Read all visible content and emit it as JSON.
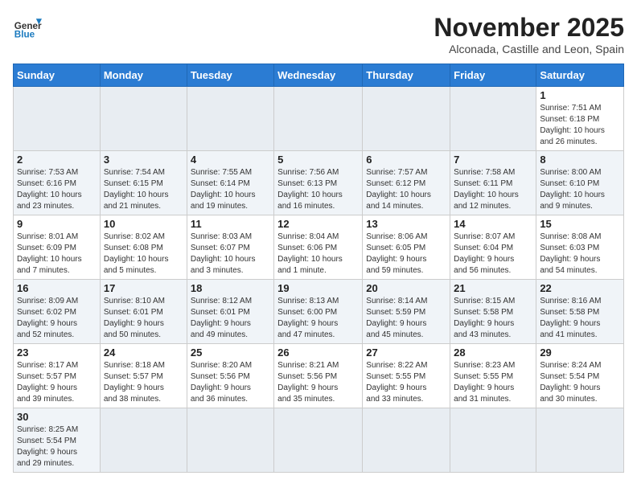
{
  "header": {
    "logo_general": "General",
    "logo_blue": "Blue",
    "month": "November 2025",
    "location": "Alconada, Castille and Leon, Spain"
  },
  "weekdays": [
    "Sunday",
    "Monday",
    "Tuesday",
    "Wednesday",
    "Thursday",
    "Friday",
    "Saturday"
  ],
  "weeks": [
    [
      {
        "day": "",
        "info": ""
      },
      {
        "day": "",
        "info": ""
      },
      {
        "day": "",
        "info": ""
      },
      {
        "day": "",
        "info": ""
      },
      {
        "day": "",
        "info": ""
      },
      {
        "day": "",
        "info": ""
      },
      {
        "day": "1",
        "info": "Sunrise: 7:51 AM\nSunset: 6:18 PM\nDaylight: 10 hours\nand 26 minutes."
      }
    ],
    [
      {
        "day": "2",
        "info": "Sunrise: 7:53 AM\nSunset: 6:16 PM\nDaylight: 10 hours\nand 23 minutes."
      },
      {
        "day": "3",
        "info": "Sunrise: 7:54 AM\nSunset: 6:15 PM\nDaylight: 10 hours\nand 21 minutes."
      },
      {
        "day": "4",
        "info": "Sunrise: 7:55 AM\nSunset: 6:14 PM\nDaylight: 10 hours\nand 19 minutes."
      },
      {
        "day": "5",
        "info": "Sunrise: 7:56 AM\nSunset: 6:13 PM\nDaylight: 10 hours\nand 16 minutes."
      },
      {
        "day": "6",
        "info": "Sunrise: 7:57 AM\nSunset: 6:12 PM\nDaylight: 10 hours\nand 14 minutes."
      },
      {
        "day": "7",
        "info": "Sunrise: 7:58 AM\nSunset: 6:11 PM\nDaylight: 10 hours\nand 12 minutes."
      },
      {
        "day": "8",
        "info": "Sunrise: 8:00 AM\nSunset: 6:10 PM\nDaylight: 10 hours\nand 9 minutes."
      }
    ],
    [
      {
        "day": "9",
        "info": "Sunrise: 8:01 AM\nSunset: 6:09 PM\nDaylight: 10 hours\nand 7 minutes."
      },
      {
        "day": "10",
        "info": "Sunrise: 8:02 AM\nSunset: 6:08 PM\nDaylight: 10 hours\nand 5 minutes."
      },
      {
        "day": "11",
        "info": "Sunrise: 8:03 AM\nSunset: 6:07 PM\nDaylight: 10 hours\nand 3 minutes."
      },
      {
        "day": "12",
        "info": "Sunrise: 8:04 AM\nSunset: 6:06 PM\nDaylight: 10 hours\nand 1 minute."
      },
      {
        "day": "13",
        "info": "Sunrise: 8:06 AM\nSunset: 6:05 PM\nDaylight: 9 hours\nand 59 minutes."
      },
      {
        "day": "14",
        "info": "Sunrise: 8:07 AM\nSunset: 6:04 PM\nDaylight: 9 hours\nand 56 minutes."
      },
      {
        "day": "15",
        "info": "Sunrise: 8:08 AM\nSunset: 6:03 PM\nDaylight: 9 hours\nand 54 minutes."
      }
    ],
    [
      {
        "day": "16",
        "info": "Sunrise: 8:09 AM\nSunset: 6:02 PM\nDaylight: 9 hours\nand 52 minutes."
      },
      {
        "day": "17",
        "info": "Sunrise: 8:10 AM\nSunset: 6:01 PM\nDaylight: 9 hours\nand 50 minutes."
      },
      {
        "day": "18",
        "info": "Sunrise: 8:12 AM\nSunset: 6:01 PM\nDaylight: 9 hours\nand 49 minutes."
      },
      {
        "day": "19",
        "info": "Sunrise: 8:13 AM\nSunset: 6:00 PM\nDaylight: 9 hours\nand 47 minutes."
      },
      {
        "day": "20",
        "info": "Sunrise: 8:14 AM\nSunset: 5:59 PM\nDaylight: 9 hours\nand 45 minutes."
      },
      {
        "day": "21",
        "info": "Sunrise: 8:15 AM\nSunset: 5:58 PM\nDaylight: 9 hours\nand 43 minutes."
      },
      {
        "day": "22",
        "info": "Sunrise: 8:16 AM\nSunset: 5:58 PM\nDaylight: 9 hours\nand 41 minutes."
      }
    ],
    [
      {
        "day": "23",
        "info": "Sunrise: 8:17 AM\nSunset: 5:57 PM\nDaylight: 9 hours\nand 39 minutes."
      },
      {
        "day": "24",
        "info": "Sunrise: 8:18 AM\nSunset: 5:57 PM\nDaylight: 9 hours\nand 38 minutes."
      },
      {
        "day": "25",
        "info": "Sunrise: 8:20 AM\nSunset: 5:56 PM\nDaylight: 9 hours\nand 36 minutes."
      },
      {
        "day": "26",
        "info": "Sunrise: 8:21 AM\nSunset: 5:56 PM\nDaylight: 9 hours\nand 35 minutes."
      },
      {
        "day": "27",
        "info": "Sunrise: 8:22 AM\nSunset: 5:55 PM\nDaylight: 9 hours\nand 33 minutes."
      },
      {
        "day": "28",
        "info": "Sunrise: 8:23 AM\nSunset: 5:55 PM\nDaylight: 9 hours\nand 31 minutes."
      },
      {
        "day": "29",
        "info": "Sunrise: 8:24 AM\nSunset: 5:54 PM\nDaylight: 9 hours\nand 30 minutes."
      }
    ],
    [
      {
        "day": "30",
        "info": "Sunrise: 8:25 AM\nSunset: 5:54 PM\nDaylight: 9 hours\nand 29 minutes."
      },
      {
        "day": "",
        "info": ""
      },
      {
        "day": "",
        "info": ""
      },
      {
        "day": "",
        "info": ""
      },
      {
        "day": "",
        "info": ""
      },
      {
        "day": "",
        "info": ""
      },
      {
        "day": "",
        "info": ""
      }
    ]
  ]
}
